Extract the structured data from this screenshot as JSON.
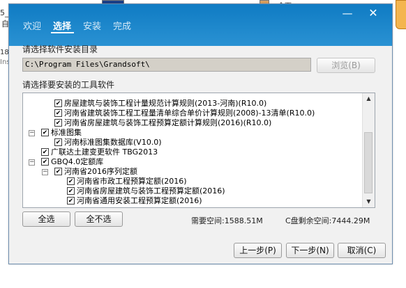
{
  "background": {
    "frag_top_left": "5_",
    "frag_left_1": "自",
    "frag_left_2": "18",
    "frag_left_3": "Ins",
    "frag_top_right": "全面"
  },
  "window": {
    "tabs": [
      {
        "label": "欢迎"
      },
      {
        "label": "选择"
      },
      {
        "label": "安装"
      },
      {
        "label": "完成"
      }
    ],
    "active_tab": "选择",
    "minimize_glyph": "—",
    "close_glyph": "✕"
  },
  "install_dir": {
    "label": "请选择软件安装目录",
    "value": "C:\\Program Files\\Grandsoft\\",
    "browse_label": "浏览(B)"
  },
  "tools": {
    "label": "请选择要安装的工具软件",
    "items": [
      {
        "text": "房屋建筑与装饰工程计量规范计算规则(2013-河南)(R10.0)",
        "level": 2,
        "checked": true,
        "expander": ""
      },
      {
        "text": "河南省建筑装饰工程工程量清单综合单价计算规则(2008)-13清单(R10.0)",
        "level": 2,
        "checked": true,
        "expander": ""
      },
      {
        "text": "河南省房屋建筑与装饰工程预算定额计算规则(2016)(R10.0)",
        "level": 2,
        "checked": true,
        "expander": ""
      },
      {
        "text": "标准图集",
        "level": 1,
        "checked": true,
        "expander": "−"
      },
      {
        "text": "河南标准图集数据库(V10.0)",
        "level": 2,
        "checked": true,
        "expander": ""
      },
      {
        "text": "广联达土建变更软件 TBG2013",
        "level": 1,
        "checked": true,
        "expander": ""
      },
      {
        "text": "GBQ4.0定额库",
        "level": 1,
        "checked": true,
        "expander": "−"
      },
      {
        "text": "河南省2016序列定额",
        "level": 2,
        "checked": true,
        "expander": "−"
      },
      {
        "text": "河南省市政工程预算定额(2016)",
        "level": 3,
        "checked": true,
        "expander": ""
      },
      {
        "text": "河南省房屋建筑与装饰工程预算定额(2016)",
        "level": 3,
        "checked": true,
        "expander": ""
      },
      {
        "text": "河南省通用安装工程预算定额(2016)",
        "level": 3,
        "checked": true,
        "expander": ""
      }
    ]
  },
  "buttons": {
    "select_all": "全选",
    "deselect_all": "全不选",
    "back": "上一步(P)",
    "next": "下一步(N)",
    "cancel": "取消(C)"
  },
  "space": {
    "required": "需要空间:1588.51M",
    "remaining": "C盘剩余空间:7444.29M"
  }
}
